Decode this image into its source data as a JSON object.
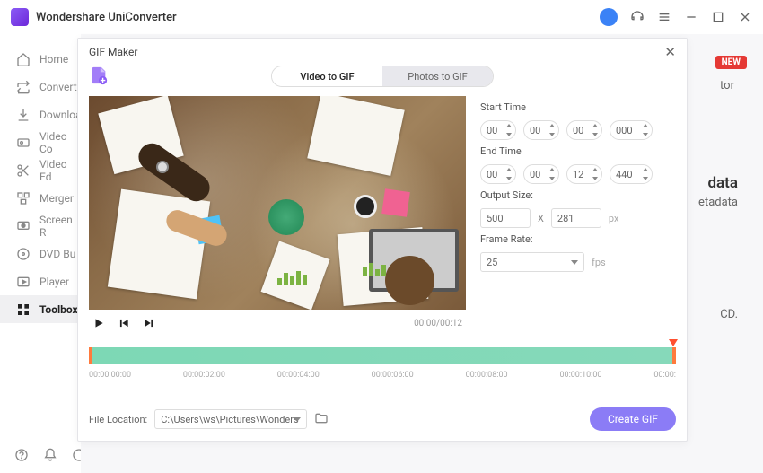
{
  "app": {
    "title": "Wondershare UniConverter"
  },
  "sidebar": {
    "items": [
      {
        "label": "Home"
      },
      {
        "label": "Converte"
      },
      {
        "label": "Downloa"
      },
      {
        "label": "Video Co"
      },
      {
        "label": "Video Ed"
      },
      {
        "label": "Merger"
      },
      {
        "label": "Screen R"
      },
      {
        "label": "DVD Bu"
      },
      {
        "label": "Player"
      },
      {
        "label": "Toolbox"
      }
    ]
  },
  "background": {
    "new_badge": "NEW",
    "tor": "tor",
    "data_big": "data",
    "data_small": "etadata",
    "cd": "CD."
  },
  "modal": {
    "title": "GIF Maker",
    "tabs": {
      "video": "Video to GIF",
      "photos": "Photos to GIF"
    },
    "player": {
      "time": "00:00/00:12"
    },
    "start": {
      "label": "Start Time",
      "h": "00",
      "m": "00",
      "s": "00",
      "ms": "000"
    },
    "end": {
      "label": "End Time",
      "h": "00",
      "m": "00",
      "s": "12",
      "ms": "440"
    },
    "output": {
      "label": "Output Size:",
      "w": "500",
      "h": "281",
      "x": "X",
      "unit": "px"
    },
    "framerate": {
      "label": "Frame Rate:",
      "value": "25",
      "unit": "fps"
    },
    "ticks": [
      "00:00:00:00",
      "00:00:02:00",
      "00:00:04:00",
      "00:00:06:00",
      "00:00:08:00",
      "00:00:10:00",
      "00:00:"
    ],
    "location": {
      "label": "File Location:",
      "path": "C:\\Users\\ws\\Pictures\\Wonders"
    },
    "create": "Create GIF"
  }
}
